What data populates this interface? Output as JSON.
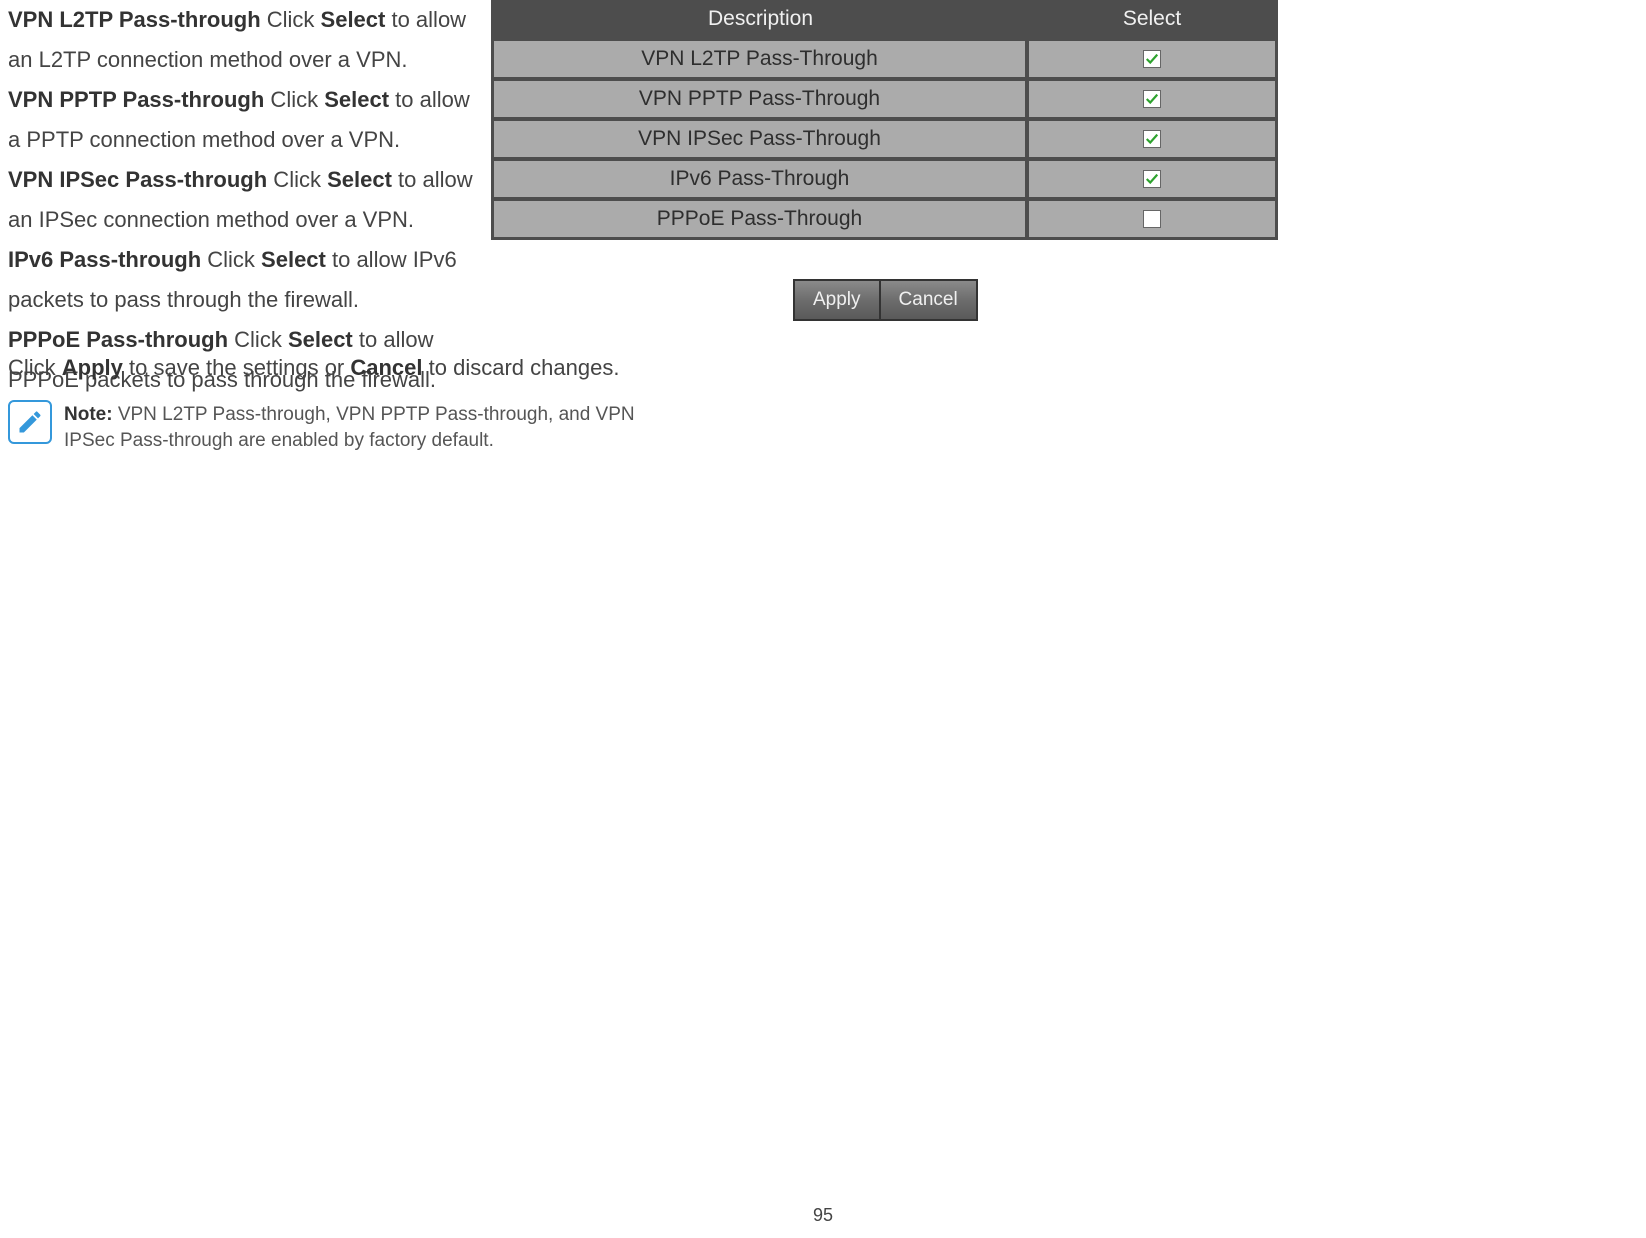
{
  "descriptions": {
    "items": [
      {
        "title": "VPN L2TP Pass-through",
        "pre": " Click ",
        "action": "Select",
        "post": " to allow an L2TP connection method over a VPN."
      },
      {
        "title": "VPN PPTP Pass-through",
        "pre": " Click ",
        "action": "Select",
        "post": " to allow a PPTP connection method over a VPN."
      },
      {
        "title": "VPN IPSec Pass-through",
        "pre": " Click ",
        "action": "Select",
        "post": " to allow an IPSec connection method over a VPN."
      },
      {
        "title": "IPv6 Pass-through",
        "pre": " Click ",
        "action": "Select",
        "post": " to allow IPv6 packets to pass through the firewall."
      },
      {
        "title": "PPPoE Pass-through",
        "pre": " Click ",
        "action": "Select",
        "post": " to allow PPPoE packets to pass through the firewall."
      }
    ],
    "apply_line": {
      "pre": "Click ",
      "apply": "Apply",
      "mid": " to save the settings or ",
      "cancel": "Cancel",
      "post": " to discard changes."
    },
    "note": {
      "label": "Note:",
      "text": " VPN L2TP Pass-through, VPN PPTP Pass-through, and VPN IPSec Pass-through are enabled by factory default."
    }
  },
  "table": {
    "headers": {
      "description": "Description",
      "select": "Select"
    },
    "rows": [
      {
        "label": "VPN L2TP Pass-Through",
        "checked": true
      },
      {
        "label": "VPN PPTP Pass-Through",
        "checked": true
      },
      {
        "label": "VPN IPSec Pass-Through",
        "checked": true
      },
      {
        "label": "IPv6 Pass-Through",
        "checked": true
      },
      {
        "label": "PPPoE Pass-Through",
        "checked": false
      }
    ]
  },
  "buttons": {
    "apply": "Apply",
    "cancel": "Cancel"
  },
  "page_number": "95",
  "colors": {
    "table_border": "#4d4d4d",
    "row_bg": "#ababab",
    "check_green": "#2ea32e",
    "note_blue": "#3498db"
  }
}
